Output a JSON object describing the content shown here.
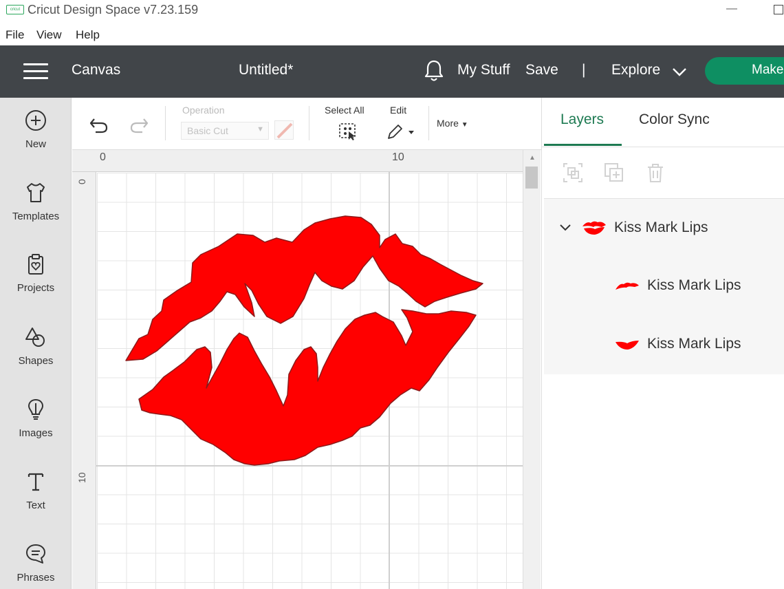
{
  "window": {
    "logo_text": "cricut",
    "title": "Cricut Design Space  v7.23.159",
    "minimize": "—"
  },
  "menu": {
    "items": [
      "File",
      "View",
      "Help"
    ]
  },
  "header": {
    "canvas_label": "Canvas",
    "document_title": "Untitled*",
    "my_stuff": "My Stuff",
    "save": "Save",
    "separator": "|",
    "explore": "Explore",
    "make": "Make",
    "accent_color": "#0e8f62",
    "bar_color": "#414549"
  },
  "sidebar": {
    "items": [
      {
        "label": "New",
        "icon": "plus-circle-icon"
      },
      {
        "label": "Templates",
        "icon": "tshirt-icon"
      },
      {
        "label": "Projects",
        "icon": "clipboard-icon"
      },
      {
        "label": "Shapes",
        "icon": "shapes-icon"
      },
      {
        "label": "Images",
        "icon": "lightbulb-icon"
      },
      {
        "label": "Text",
        "icon": "text-icon"
      },
      {
        "label": "Phrases",
        "icon": "speech-bubble-icon"
      }
    ]
  },
  "toolbar": {
    "operation_label": "Operation",
    "operation_value": "Basic Cut",
    "select_all": "Select All",
    "edit": "Edit",
    "more": "More"
  },
  "canvas": {
    "ruler_top": [
      "0",
      "10"
    ],
    "ruler_left": [
      "0",
      "10"
    ],
    "shape_color": "#ff0000"
  },
  "panel": {
    "tabs": [
      "Layers",
      "Color Sync"
    ],
    "active_tab": "Layers",
    "layers": [
      {
        "name": "Kiss Mark Lips",
        "level": 0,
        "expanded": true
      },
      {
        "name": "Kiss Mark Lips",
        "level": 1
      },
      {
        "name": "Kiss Mark Lips",
        "level": 1
      }
    ]
  }
}
